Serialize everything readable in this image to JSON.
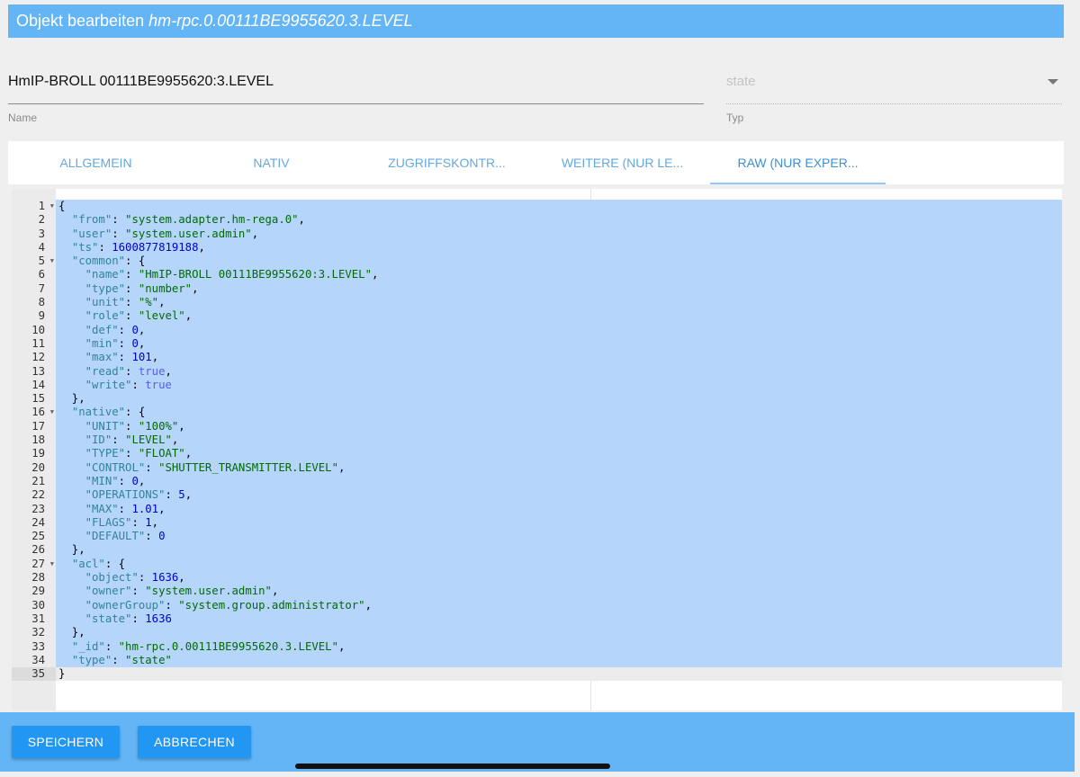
{
  "title": {
    "prefix": "Objekt bearbeiten",
    "object_id": "hm-rpc.0.00111BE9955620.3.LEVEL"
  },
  "name_field": {
    "value": "HmIP-BROLL 00111BE9955620:3.LEVEL",
    "label": "Name"
  },
  "type_field": {
    "placeholder": "state",
    "label": "Typ"
  },
  "tabs": [
    {
      "label": "ALLGEMEIN"
    },
    {
      "label": "NATIV"
    },
    {
      "label": "ZUGRIFFSKONTR..."
    },
    {
      "label": "WEITERE (NUR LE..."
    },
    {
      "label": "RAW (NUR EXPER...",
      "active": true
    }
  ],
  "editor": {
    "lines": [
      "{",
      "  \"from\": \"system.adapter.hm-rega.0\",",
      "  \"user\": \"system.user.admin\",",
      "  \"ts\": 1600877819188,",
      "  \"common\": {",
      "    \"name\": \"HmIP-BROLL 00111BE9955620:3.LEVEL\",",
      "    \"type\": \"number\",",
      "    \"unit\": \"%\",",
      "    \"role\": \"level\",",
      "    \"def\": 0,",
      "    \"min\": 0,",
      "    \"max\": 101,",
      "    \"read\": true,",
      "    \"write\": true",
      "  },",
      "  \"native\": {",
      "    \"UNIT\": \"100%\",",
      "    \"ID\": \"LEVEL\",",
      "    \"TYPE\": \"FLOAT\",",
      "    \"CONTROL\": \"SHUTTER_TRANSMITTER.LEVEL\",",
      "    \"MIN\": 0,",
      "    \"OPERATIONS\": 5,",
      "    \"MAX\": 1.01,",
      "    \"FLAGS\": 1,",
      "    \"DEFAULT\": 0",
      "  },",
      "  \"acl\": {",
      "    \"object\": 1636,",
      "    \"owner\": \"system.user.admin\",",
      "    \"ownerGroup\": \"system.group.administrator\",",
      "    \"state\": 1636",
      "  },",
      "  \"_id\": \"hm-rpc.0.00111BE9955620.3.LEVEL\",",
      "  \"type\": \"state\"",
      "}"
    ],
    "fold_lines": [
      1,
      5,
      16,
      27
    ],
    "current_line": 35
  },
  "buttons": {
    "save": "SPEICHERN",
    "cancel": "ABBRECHEN"
  }
}
